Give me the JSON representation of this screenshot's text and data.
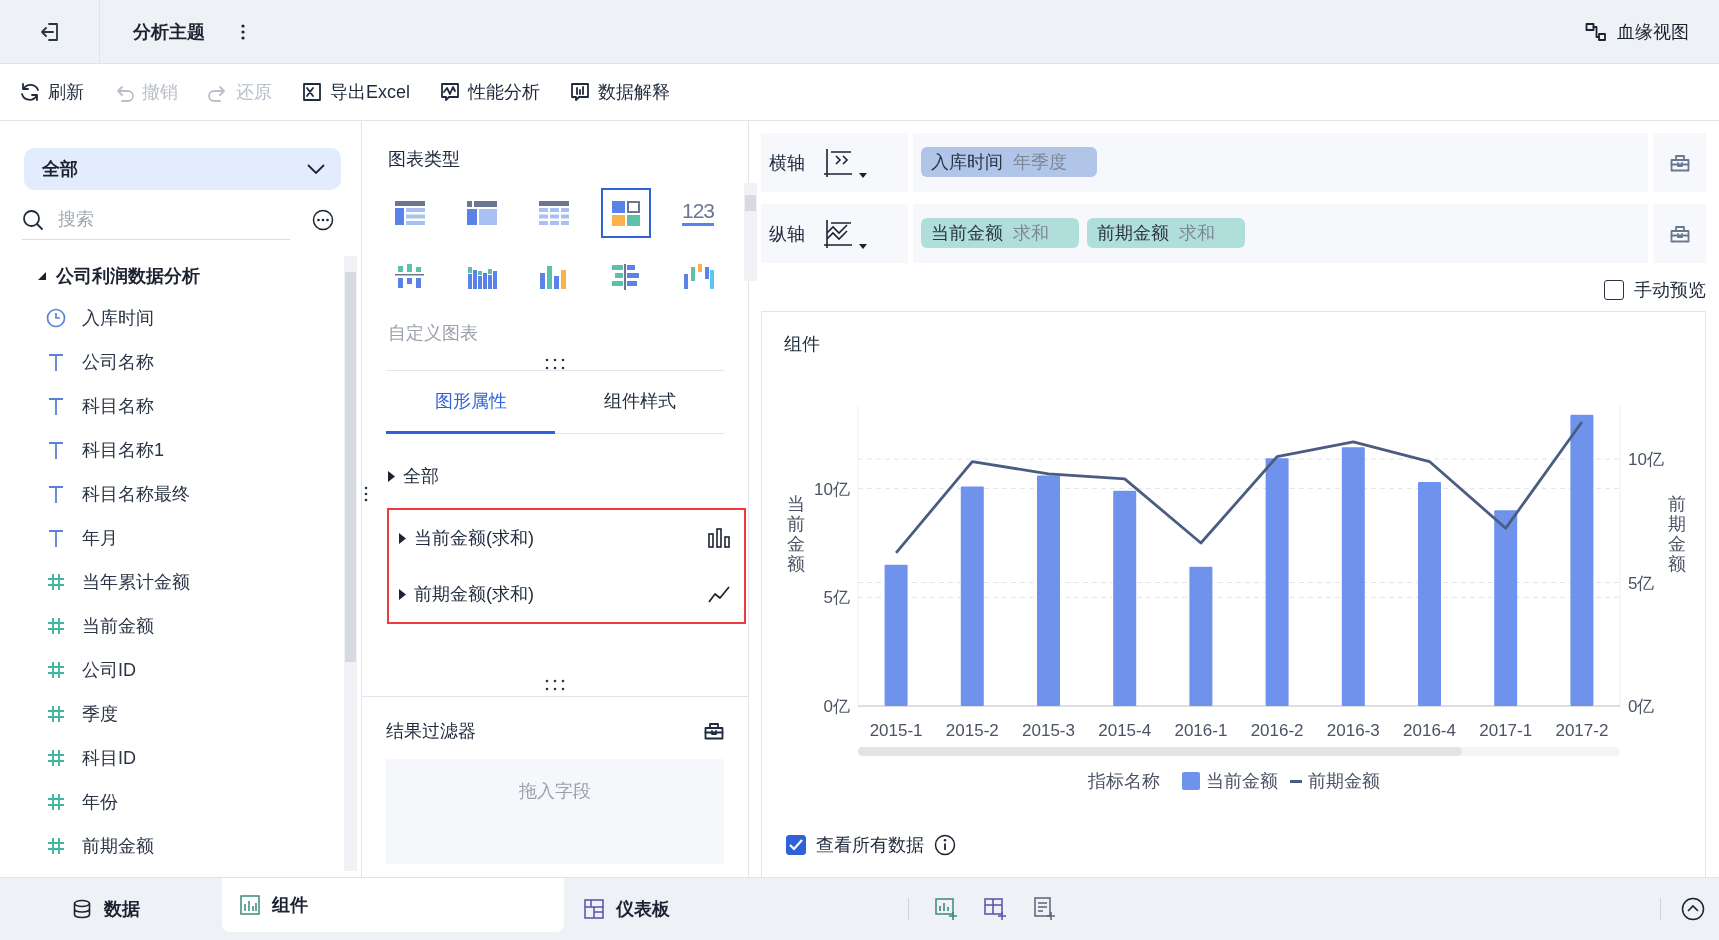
{
  "header": {
    "title": "分析主题",
    "lineage": "血缘视图"
  },
  "toolbar": [
    {
      "label": "刷新",
      "kind": "refresh",
      "disabled": false
    },
    {
      "label": "撤销",
      "kind": "undo",
      "disabled": true
    },
    {
      "label": "还原",
      "kind": "redo",
      "disabled": true
    },
    {
      "label": "导出Excel",
      "kind": "excel",
      "disabled": false
    },
    {
      "label": "性能分析",
      "kind": "performance",
      "disabled": false
    },
    {
      "label": "数据解释",
      "kind": "explain",
      "disabled": false
    }
  ],
  "data_panel": {
    "dropdown": "全部",
    "search_placeholder": "搜索",
    "tree": {
      "label": "公司利润数据分析",
      "expanded": true,
      "children": [
        {
          "label": "入库时间",
          "kind": "date"
        },
        {
          "label": "公司名称",
          "kind": "text"
        },
        {
          "label": "科目名称",
          "kind": "text"
        },
        {
          "label": "科目名称1",
          "kind": "text"
        },
        {
          "label": "科目名称最终",
          "kind": "text"
        },
        {
          "label": "年月",
          "kind": "text"
        },
        {
          "label": "当年累计金额",
          "kind": "number"
        },
        {
          "label": "当前金额",
          "kind": "number"
        },
        {
          "label": "公司ID",
          "kind": "number"
        },
        {
          "label": "季度",
          "kind": "number"
        },
        {
          "label": "科目ID",
          "kind": "number"
        },
        {
          "label": "年份",
          "kind": "number"
        },
        {
          "label": "前期金额",
          "kind": "number"
        }
      ]
    }
  },
  "chart_types": {
    "title": "图表类型",
    "custom": "自定义图表",
    "types": [
      {
        "kind": "group-table",
        "selected": false
      },
      {
        "kind": "cross-table",
        "selected": false
      },
      {
        "kind": "detail-table",
        "selected": false
      },
      {
        "kind": "custom",
        "selected": true
      },
      {
        "kind": "kpi",
        "label": "123",
        "selected": false
      },
      {
        "kind": "stacked-column",
        "selected": false
      },
      {
        "kind": "grouped-column",
        "selected": false
      },
      {
        "kind": "column",
        "selected": false
      },
      {
        "kind": "bar",
        "selected": false
      },
      {
        "kind": "waterfall",
        "selected": false
      }
    ]
  },
  "property_tabs": [
    {
      "label": "图形属性",
      "selected": true
    },
    {
      "label": "组件样式",
      "selected": false
    }
  ],
  "properties": {
    "all": "全部",
    "highlighted": true,
    "measures": [
      {
        "label": "当前金额(求和)",
        "kind": "bar"
      },
      {
        "label": "前期金额(求和)",
        "kind": "line"
      }
    ]
  },
  "result_filter": {
    "title": "结果过滤器",
    "placeholder": "拖入字段"
  },
  "axes": [
    {
      "label": "横轴",
      "kind": "x",
      "fields": [
        {
          "name": "入库时间",
          "aggregation": "年季度",
          "kind": "dimension"
        }
      ]
    },
    {
      "label": "纵轴",
      "kind": "y",
      "fields": [
        {
          "name": "当前金额",
          "aggregation": "求和",
          "kind": "measure"
        },
        {
          "name": "前期金额",
          "aggregation": "求和",
          "kind": "measure"
        }
      ]
    }
  ],
  "manual_preview": {
    "label": "手动预览",
    "checked": false
  },
  "component": {
    "title": "组件",
    "legend_title": "指标名称",
    "show_all": {
      "label": "查看所有数据",
      "checked": true
    },
    "chart_data": {
      "type": "bar",
      "ylabel": "当前金额",
      "y2label": "前期金额",
      "categories": [
        "2015-1",
        "2015-2",
        "2015-3",
        "2015-4",
        "2016-1",
        "2016-2",
        "2016-3",
        "2016-4",
        "2017-1",
        "2017-2"
      ],
      "grid": true,
      "legend": "bottom",
      "ylim": [
        0,
        13.8
      ],
      "y2lim": [
        0,
        12.15
      ],
      "yticks": [
        {
          "value": 0,
          "label": "0亿"
        },
        {
          "value": 5,
          "label": "5亿"
        },
        {
          "value": 10,
          "label": "10亿"
        }
      ],
      "y2ticks": [
        {
          "value": 0,
          "label": "0亿"
        },
        {
          "value": 5,
          "label": "5亿"
        },
        {
          "value": 10,
          "label": "10亿"
        }
      ],
      "series": [
        {
          "name": "当前金额",
          "axis": "y",
          "color": "#6f92ec",
          "values": [
            6.5,
            10.1,
            10.6,
            9.9,
            6.4,
            11.4,
            11.9,
            10.3,
            9.0,
            13.4
          ]
        },
        {
          "name": "前期金额",
          "type": "line",
          "axis": "y2",
          "color": "#4a5d80",
          "values": [
            6.2,
            9.9,
            9.4,
            9.2,
            6.6,
            10.1,
            10.7,
            9.9,
            7.2,
            11.5
          ]
        }
      ]
    }
  },
  "bottom_tabs": [
    {
      "label": "数据",
      "kind": "data",
      "selected": false
    },
    {
      "label": "组件",
      "kind": "widget",
      "selected": true
    },
    {
      "label": "仪表板",
      "kind": "dashboard",
      "selected": false
    }
  ]
}
